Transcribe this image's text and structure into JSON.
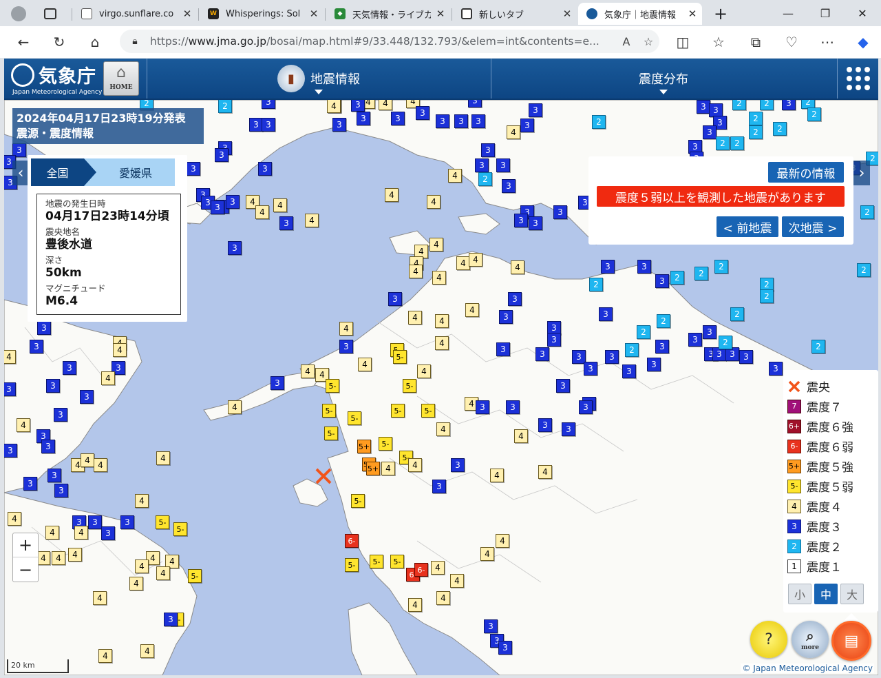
{
  "browser": {
    "tabs": [
      {
        "title": "",
        "icon": "profile-avatar"
      },
      {
        "title": "",
        "icon": "tab-actions"
      },
      {
        "title": "virgo.sunflare.co",
        "icon": "page-icon"
      },
      {
        "title": "Whisperings: Sol",
        "icon": "spr-icon"
      },
      {
        "title": "天気情報・ライブカ",
        "icon": "weather-icon"
      },
      {
        "title": "新しいタブ",
        "icon": "newtab-icon"
      },
      {
        "title": "気象庁｜地震情報",
        "icon": "jma-icon"
      }
    ],
    "url_prefix": "https://",
    "url_host": "www.jma.go.jp",
    "url_path": "/bosai/map.html#9/33.448/132.793/&elem=int&contents=e..."
  },
  "header": {
    "logo_text": "気象庁",
    "logo_sub": "Japan Meteorological Agency",
    "home_label": "HOME",
    "menu1": "地震情報",
    "menu2": "震度分布"
  },
  "info": {
    "issued": "2024年04月17日23時19分発表",
    "kind": "震源・震度情報",
    "area_all": "全国",
    "area_pref": "愛媛県",
    "occurred_label": "地震の発生日時",
    "occurred_value": "04月17日23時14分頃",
    "place_label": "震央地名",
    "place_value": "豊後水道",
    "depth_label": "深さ",
    "depth_value": "50km",
    "mag_label": "マグニチュード",
    "mag_value": "M6.4"
  },
  "latest": {
    "button": "最新の情報",
    "alert": "震度５弱以上を観測した地震があります",
    "prev": "< 前地震",
    "next": "次地震 >"
  },
  "legend": {
    "items": [
      {
        "mark": "",
        "label": "震央"
      },
      {
        "mark": "7",
        "label": "震度７",
        "color": "#a0107a"
      },
      {
        "mark": "6+",
        "label": "震度６強",
        "color": "#a0102a"
      },
      {
        "mark": "6-",
        "label": "震度６弱",
        "color": "#e8321e"
      },
      {
        "mark": "5+",
        "label": "震度５強",
        "color": "#ff9b20"
      },
      {
        "mark": "5-",
        "label": "震度５弱",
        "color": "#ffe52e"
      },
      {
        "mark": "4",
        "label": "震度４",
        "color": "#fff0b0"
      },
      {
        "mark": "3",
        "label": "震度３",
        "color": "#1c31d8"
      },
      {
        "mark": "2",
        "label": "震度２",
        "color": "#1fb6f0"
      },
      {
        "mark": "1",
        "label": "震度１",
        "color": "#ffffff"
      }
    ],
    "size_small": "小",
    "size_mid": "中",
    "size_large": "大"
  },
  "map": {
    "scale_label": "20 km",
    "copyright": "© Japan Meteorological Agency",
    "more_label": "more"
  },
  "stations": [
    [
      "2",
      213,
      150
    ],
    [
      "3",
      390,
      148
    ],
    [
      "4",
      486,
      154
    ],
    [
      "4",
      535,
      148
    ],
    [
      "4",
      560,
      150
    ],
    [
      "4",
      600,
      147
    ],
    [
      "3",
      690,
      146
    ],
    [
      "2",
      327,
      154
    ],
    [
      "3",
      520,
      152
    ],
    [
      "3",
      578,
      172
    ],
    [
      "3",
      614,
      164
    ],
    [
      "3",
      643,
      176
    ],
    [
      "3",
      670,
      176
    ],
    [
      "3",
      695,
      176
    ],
    [
      "3",
      778,
      160
    ],
    [
      "4",
      746,
      192
    ],
    [
      "3",
      766,
      182
    ],
    [
      "2",
      870,
      177
    ],
    [
      "3",
      372,
      181
    ],
    [
      "3",
      390,
      181
    ],
    [
      "3",
      493,
      181
    ],
    [
      "3",
      528,
      172
    ],
    [
      "3",
      28,
      218
    ],
    [
      "3",
      327,
      215
    ],
    [
      "3",
      322,
      225
    ],
    [
      "3",
      709,
      218
    ],
    [
      "3",
      700,
      240
    ],
    [
      "3",
      731,
      240
    ],
    [
      "2",
      705,
      260
    ],
    [
      "3",
      739,
      270
    ],
    [
      "4",
      661,
      255
    ],
    [
      "3",
      281,
      245
    ],
    [
      "3",
      385,
      245
    ],
    [
      "3",
      15,
      265
    ],
    [
      "3",
      295,
      283
    ],
    [
      "3",
      302,
      294
    ],
    [
      "3",
      323,
      300
    ],
    [
      "3",
      338,
      293
    ],
    [
      "3",
      316,
      301
    ],
    [
      "4",
      367,
      293
    ],
    [
      "4",
      381,
      308
    ],
    [
      "4",
      407,
      298
    ],
    [
      "3",
      416,
      324
    ],
    [
      "4",
      453,
      320
    ],
    [
      "4",
      569,
      283
    ],
    [
      "4",
      630,
      293
    ],
    [
      "3",
      341,
      360
    ],
    [
      "3",
      766,
      308
    ],
    [
      "3",
      757,
      320
    ],
    [
      "3",
      778,
      324
    ],
    [
      "3",
      814,
      308
    ],
    [
      "3",
      850,
      294
    ],
    [
      "4",
      634,
      355
    ],
    [
      "4",
      612,
      365
    ],
    [
      "4",
      605,
      382
    ],
    [
      "4",
      604,
      394
    ],
    [
      "4",
      673,
      382
    ],
    [
      "4",
      691,
      377
    ],
    [
      "4",
      638,
      403
    ],
    [
      "4",
      752,
      388
    ],
    [
      "3",
      574,
      434
    ],
    [
      "3",
      748,
      434
    ],
    [
      "4",
      686,
      450
    ],
    [
      "3",
      735,
      460
    ],
    [
      "4",
      603,
      461
    ],
    [
      "4",
      642,
      466
    ],
    [
      "3",
      805,
      476
    ],
    [
      "3",
      805,
      493
    ],
    [
      "4",
      642,
      498
    ],
    [
      "4",
      503,
      477
    ],
    [
      "3",
      503,
      503
    ],
    [
      "4",
      530,
      529
    ],
    [
      "3",
      731,
      507
    ],
    [
      "3",
      788,
      514
    ],
    [
      "3",
      841,
      518
    ],
    [
      "3",
      858,
      535
    ],
    [
      "3",
      889,
      518
    ],
    [
      "3",
      914,
      539
    ],
    [
      "3",
      950,
      529
    ],
    [
      "3",
      880,
      456
    ],
    [
      "2",
      964,
      466
    ],
    [
      "2",
      935,
      482
    ],
    [
      "3",
      962,
      503
    ],
    [
      "2",
      918,
      508
    ],
    [
      "3",
      883,
      387
    ],
    [
      "3",
      936,
      387
    ],
    [
      "3",
      962,
      408
    ],
    [
      "2",
      984,
      403
    ],
    [
      "2",
      1019,
      397
    ],
    [
      "2",
      1048,
      387
    ],
    [
      "2",
      866,
      413
    ],
    [
      "2",
      1114,
      413
    ],
    [
      "2",
      1114,
      430
    ],
    [
      "2",
      1071,
      456
    ],
    [
      "3",
      1031,
      482
    ],
    [
      "3",
      1010,
      493
    ],
    [
      "3",
      1033,
      514
    ],
    [
      "3",
      1045,
      514
    ],
    [
      "3",
      1064,
      514
    ],
    [
      "3",
      1084,
      518
    ],
    [
      "2",
      1054,
      497
    ],
    [
      "2",
      1189,
      503
    ],
    [
      "3",
      1127,
      535
    ],
    [
      "2",
      1255,
      392
    ],
    [
      "2",
      1260,
      308
    ],
    [
      "2",
      1268,
      230
    ],
    [
      "3",
      1022,
      155
    ],
    [
      "3",
      1040,
      160
    ],
    [
      "3",
      1046,
      178
    ],
    [
      "3",
      1031,
      192
    ],
    [
      "3",
      1010,
      213
    ],
    [
      "2",
      1050,
      208
    ],
    [
      "2",
      1071,
      208
    ],
    [
      "3",
      1012,
      230
    ],
    [
      "2",
      1074,
      150
    ],
    [
      "2",
      1114,
      150
    ],
    [
      "3",
      1146,
      150
    ],
    [
      "2",
      1174,
      148
    ],
    [
      "2",
      1183,
      166
    ],
    [
      "2",
      1098,
      172
    ],
    [
      "2",
      1098,
      192
    ],
    [
      "2",
      1133,
      187
    ],
    [
      "3",
      1240,
      244
    ],
    [
      "5-",
      577,
      508
    ],
    [
      "5-",
      581,
      518
    ],
    [
      "4",
      447,
      539
    ],
    [
      "4",
      468,
      544
    ],
    [
      "5-",
      483,
      560
    ],
    [
      "4",
      616,
      539
    ],
    [
      "5-",
      595,
      560
    ],
    [
      "3",
      403,
      556
    ],
    [
      "3",
      818,
      560
    ],
    [
      "5-",
      478,
      596
    ],
    [
      "5-",
      515,
      607
    ],
    [
      "5-",
      578,
      596
    ],
    [
      "5-",
      622,
      596
    ],
    [
      "4",
      685,
      586
    ],
    [
      "3",
      745,
      591
    ],
    [
      "3",
      856,
      586
    ],
    [
      "3",
      851,
      591
    ],
    [
      "3",
      701,
      591
    ],
    [
      "4",
      341,
      591
    ],
    [
      "5-",
      481,
      629
    ],
    [
      "5+",
      529,
      648
    ],
    [
      "5-",
      560,
      644
    ],
    [
      "4",
      644,
      623
    ],
    [
      "4",
      757,
      633
    ],
    [
      "3",
      792,
      617
    ],
    [
      "3",
      826,
      623
    ],
    [
      "5-",
      590,
      664
    ],
    [
      "5+",
      536,
      674
    ],
    [
      "5+",
      542,
      680
    ],
    [
      "4",
      564,
      680
    ],
    [
      "4",
      603,
      675
    ],
    [
      "3",
      665,
      675
    ],
    [
      "3",
      638,
      706
    ],
    [
      "4",
      722,
      690
    ],
    [
      "4",
      792,
      685
    ],
    [
      "5-",
      520,
      727
    ],
    [
      "6-",
      511,
      785
    ],
    [
      "5-",
      511,
      820
    ],
    [
      "5-",
      547,
      815
    ],
    [
      "5-",
      577,
      815
    ],
    [
      "6-",
      600,
      834
    ],
    [
      "6-",
      612,
      827
    ],
    [
      "4",
      730,
      785
    ],
    [
      "4",
      708,
      804
    ],
    [
      "4",
      636,
      824
    ],
    [
      "4",
      664,
      843
    ],
    [
      "4",
      644,
      868
    ],
    [
      "4",
      603,
      878
    ],
    [
      "3",
      713,
      909
    ],
    [
      "3",
      722,
      930
    ],
    [
      "3",
      734,
      940
    ],
    [
      "4",
      485,
      154
    ],
    [
      "3",
      64,
      476
    ],
    [
      "3",
      53,
      503
    ],
    [
      "4",
      174,
      498
    ],
    [
      "4",
      174,
      508
    ],
    [
      "3",
      172,
      534
    ],
    [
      "4",
      157,
      549
    ],
    [
      "3",
      101,
      534
    ],
    [
      "3",
      77,
      560
    ],
    [
      "3",
      126,
      576
    ],
    [
      "3",
      13,
      565
    ],
    [
      "4",
      34,
      617
    ],
    [
      "3",
      88,
      602
    ],
    [
      "3",
      63,
      633
    ],
    [
      "3",
      70,
      648
    ],
    [
      "3",
      15,
      654
    ],
    [
      "4",
      113,
      675
    ],
    [
      "4",
      127,
      668
    ],
    [
      "4",
      146,
      675
    ],
    [
      "3",
      79,
      690
    ],
    [
      "3",
      44,
      702
    ],
    [
      "3",
      89,
      712
    ],
    [
      "4",
      237,
      665
    ],
    [
      "4",
      206,
      727
    ],
    [
      "4",
      21,
      753
    ],
    [
      "3",
      115,
      758
    ],
    [
      "3",
      138,
      758
    ],
    [
      "3",
      157,
      774
    ],
    [
      "3",
      185,
      758
    ],
    [
      "5-",
      236,
      758
    ],
    [
      "5-",
      262,
      768
    ],
    [
      "4",
      76,
      773
    ],
    [
      "4",
      118,
      773
    ],
    [
      "4",
      109,
      805
    ],
    [
      "4",
      63,
      810
    ],
    [
      "4",
      85,
      810
    ],
    [
      "4",
      222,
      810
    ],
    [
      "4",
      250,
      815
    ],
    [
      "4",
      206,
      822
    ],
    [
      "4",
      237,
      832
    ],
    [
      "5-",
      283,
      836
    ],
    [
      "4",
      198,
      847
    ],
    [
      "4",
      145,
      868
    ],
    [
      "5-",
      257,
      899
    ],
    [
      "3",
      248,
      899
    ],
    [
      "4",
      153,
      952
    ],
    [
      "4",
      214,
      945
    ],
    [
      "3",
      13,
      235
    ],
    [
      "4",
      13,
      518
    ]
  ]
}
